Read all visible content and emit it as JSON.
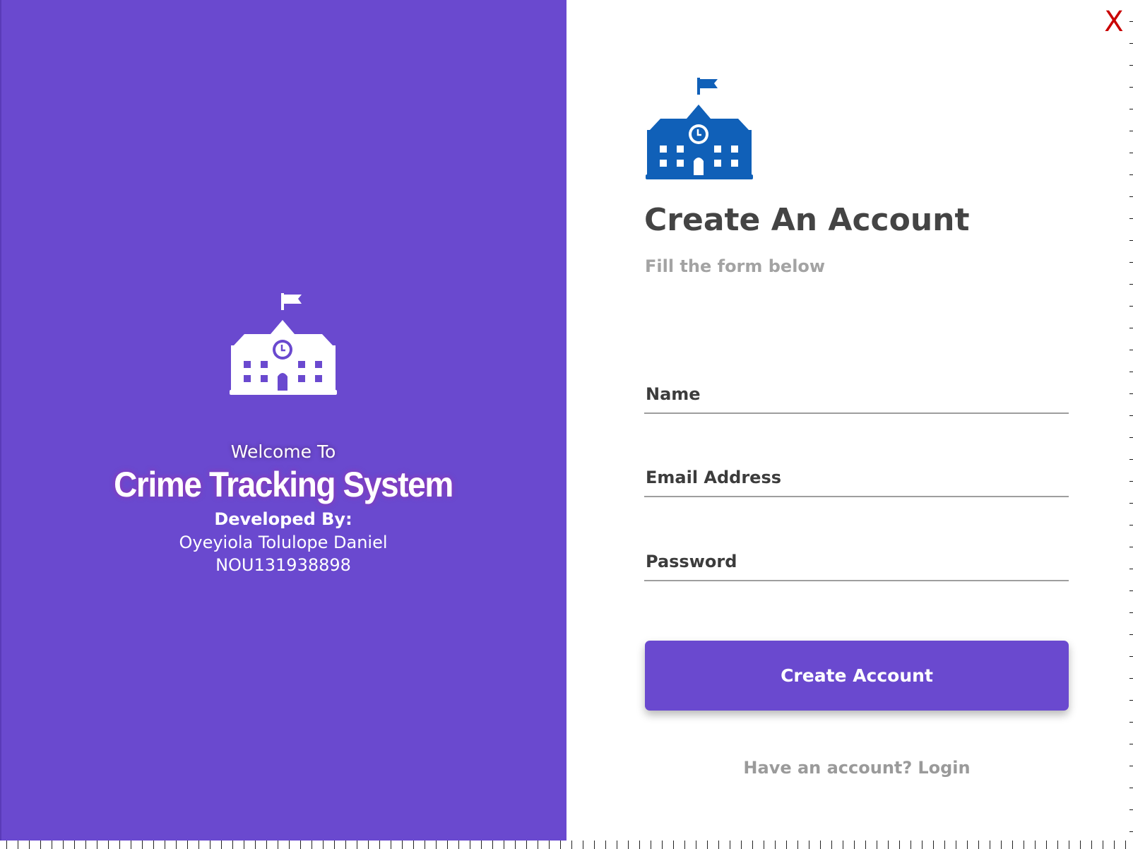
{
  "left_panel": {
    "background_color": "#6a49cf",
    "icon": "school-building-icon",
    "welcome": "Welcome To",
    "app_name": "Crime Tracking System",
    "developed_by": "Developed By:",
    "developer_name": "Oyeyiola Tolulope Daniel",
    "developer_id": "NOU131938898"
  },
  "right_panel": {
    "close_label": "X",
    "close_color": "#c90000",
    "icon": "school-building-icon",
    "icon_color": "#1060b8",
    "title": "Create An Account",
    "subtitle": "Fill the form below",
    "fields": {
      "name": {
        "placeholder": "Name",
        "value": ""
      },
      "email": {
        "placeholder": "Email Address",
        "value": ""
      },
      "password": {
        "placeholder": "Password",
        "value": ""
      }
    },
    "submit_label": "Create Account",
    "login_prompt": "Have an account?",
    "login_link": "Login"
  }
}
